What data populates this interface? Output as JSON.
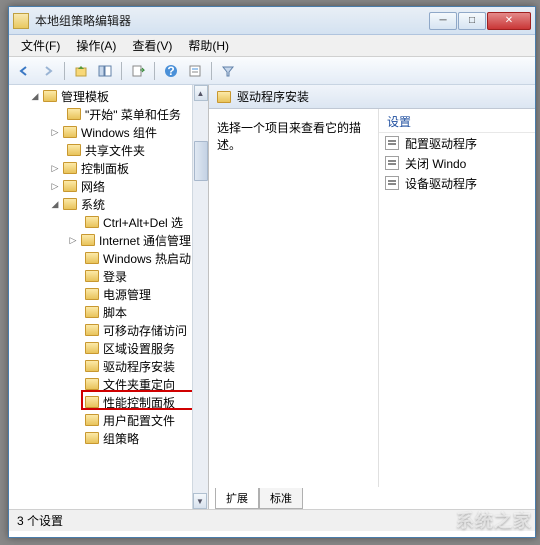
{
  "window": {
    "title": "本地组策略编辑器"
  },
  "menu": {
    "file": "文件(F)",
    "action": "操作(A)",
    "view": "查看(V)",
    "help": "帮助(H)"
  },
  "tree": {
    "root": "管理模板",
    "items": [
      "\"开始\" 菜单和任务",
      "Windows 组件",
      "共享文件夹",
      "控制面板",
      "网络"
    ],
    "system": "系统",
    "system_children": [
      "Ctrl+Alt+Del 选",
      "Internet 通信管理",
      "Windows 热启动",
      "登录",
      "电源管理",
      "脚本",
      "可移动存储访问",
      "区域设置服务",
      "驱动程序安装",
      "文件夹重定向",
      "性能控制面板",
      "用户配置文件",
      "组策略"
    ]
  },
  "right": {
    "header": "驱动程序安装",
    "description": "选择一个项目来查看它的描述。",
    "settings_label": "设置",
    "settings": [
      "配置驱动程序",
      "关闭 Windo",
      "设备驱动程序"
    ],
    "tabs": {
      "extended": "扩展",
      "standard": "标准"
    }
  },
  "status": "3 个设置",
  "watermark": "系统之家"
}
